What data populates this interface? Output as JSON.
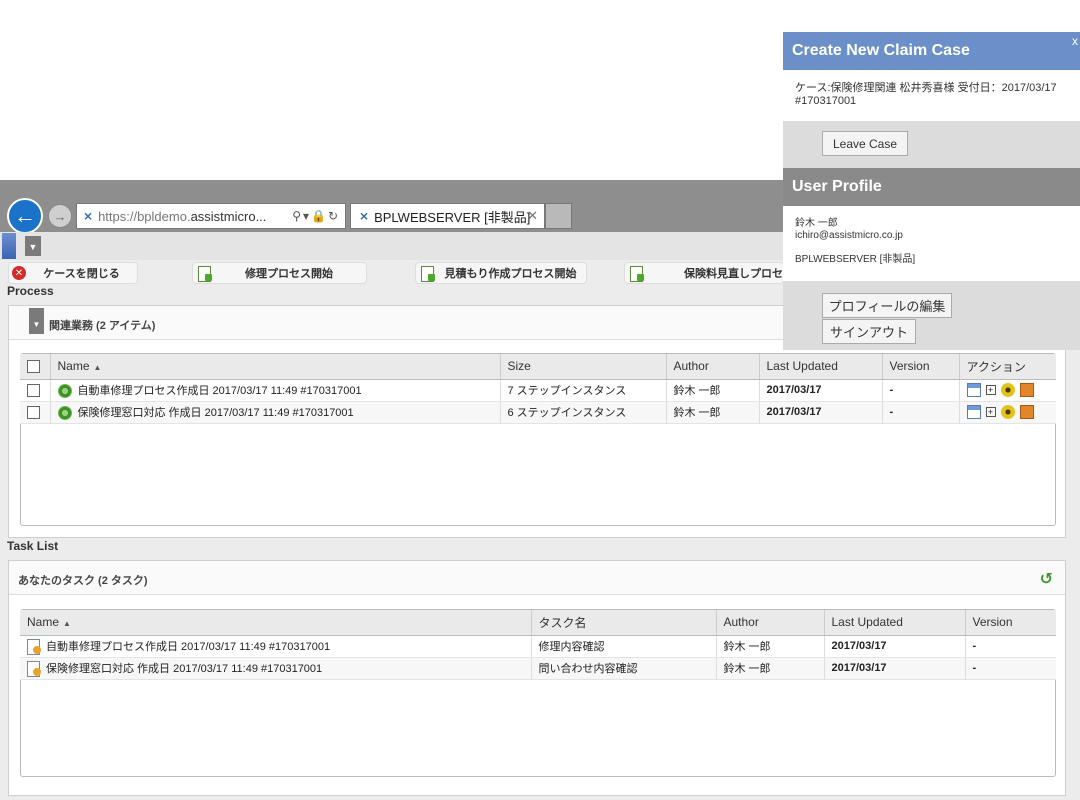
{
  "browser": {
    "url_prefix": "https://bpldemo.",
    "url_host": "assistmicro...",
    "tab_title": "BPLWEBSERVER [非製品]"
  },
  "toolbar": {
    "close_case": "ケースを閉じる",
    "repair_process": "修理プロセス開始",
    "estimate_process": "見積もり作成プロセス開始",
    "premium_review": "保険料見直しプロセ"
  },
  "process_section": {
    "label": "Process",
    "panel_title": "関連業務 (2 アイテム)",
    "columns": [
      "Name",
      "Size",
      "Author",
      "Last Updated",
      "Version",
      "アクション"
    ],
    "rows": [
      {
        "name": "自動車修理プロセス作成日 2017/03/17 11:49 #170317001",
        "size": "7 ステップインスタンス",
        "author": "鈴木 一郎",
        "updated": "2017/03/17",
        "version": "-"
      },
      {
        "name": "保険修理窓口対応 作成日 2017/03/17 11:49 #170317001",
        "size": "6 ステップインスタンス",
        "author": "鈴木 一郎",
        "updated": "2017/03/17",
        "version": "-"
      }
    ]
  },
  "task_section": {
    "label": "Task List",
    "panel_title": "あなたのタスク (2 タスク)",
    "columns": [
      "Name",
      "タスク名",
      "Author",
      "Last Updated",
      "Version"
    ],
    "rows": [
      {
        "name": "自動車修理プロセス作成日 2017/03/17 11:49 #170317001",
        "task": "修理内容確認",
        "author": "鈴木 一郎",
        "updated": "2017/03/17",
        "version": "-"
      },
      {
        "name": "保険修理窓口対応 作成日 2017/03/17 11:49 #170317001",
        "task": "問い合わせ内容確認",
        "author": "鈴木 一郎",
        "updated": "2017/03/17",
        "version": "-"
      }
    ]
  },
  "claim_popup": {
    "title": "Create New Claim Case",
    "close": "x",
    "info_line1": "ケース:保険修理関連 松井秀喜様 受付日：2017/03/17",
    "info_line2": "#170317001",
    "leave_button": "Leave Case"
  },
  "profile_popup": {
    "title": "User Profile",
    "name": "鈴木 一郎",
    "email": "ichiro@assistmicro.co.jp",
    "server": "BPLWEBSERVER [非製品]",
    "edit_button": "プロフィールの編集",
    "signout_button": "サインアウト"
  },
  "colors": {
    "claim_header": "#6b8fc8",
    "profile_header": "#8a8a8a",
    "back_button": "#1a73c9"
  }
}
